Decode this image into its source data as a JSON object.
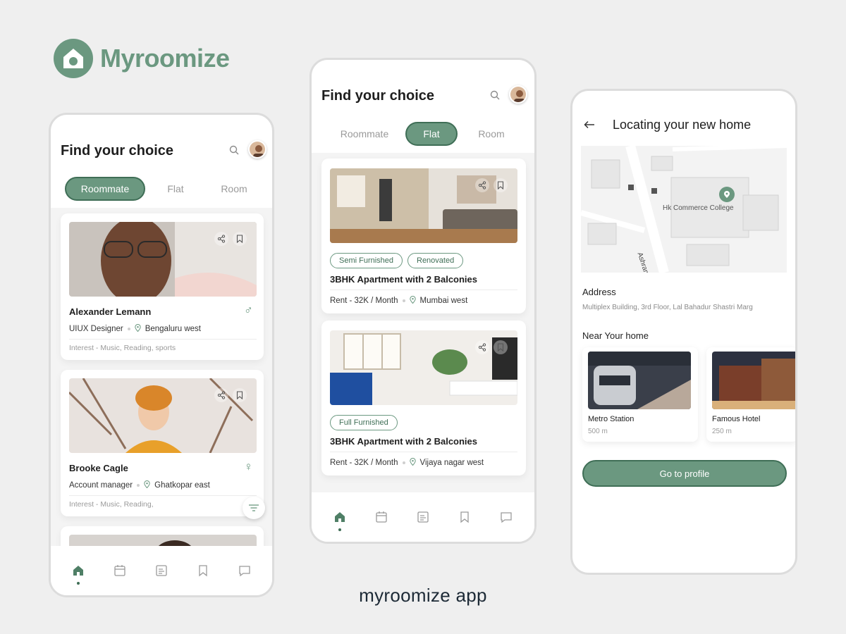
{
  "brand": {
    "name": "Myroomize",
    "color": "#6b9880",
    "logo_icon": "house-icon"
  },
  "caption": "myroomize app",
  "colors": {
    "accent": "#6b9880",
    "accent_dark": "#3f6e56",
    "background": "#efefef"
  },
  "screen1": {
    "title": "Find your choice",
    "tabs": [
      {
        "label": "Roommate",
        "active": true
      },
      {
        "label": "Flat",
        "active": false
      },
      {
        "label": "Room",
        "active": false
      }
    ],
    "cards": [
      {
        "name": "Alexander Lemann",
        "gender_icon": "male-symbol-icon",
        "gender_symbol": "♂",
        "role": "UIUX Designer",
        "location": "Bengaluru west",
        "interest": "Interest - Music, Reading, sports"
      },
      {
        "name": "Brooke Cagle",
        "gender_icon": "female-symbol-icon",
        "gender_symbol": "♀",
        "role": "Account manager",
        "location": "Ghatkopar east",
        "interest": "Interest - Music, Reading,"
      }
    ],
    "nav": [
      "home-icon",
      "calendar-icon",
      "notes-icon",
      "bookmark-icon",
      "chat-icon"
    ]
  },
  "screen2": {
    "title": "Find your choice",
    "tabs": [
      {
        "label": "Roommate",
        "active": false
      },
      {
        "label": "Flat",
        "active": true
      },
      {
        "label": "Room",
        "active": false
      }
    ],
    "cards": [
      {
        "tags": [
          "Semi Furnished",
          "Renovated"
        ],
        "title": "3BHK Apartment with 2 Balconies",
        "rent": "Rent - 32K / Month",
        "location": "Mumbai west"
      },
      {
        "tags": [
          "Full Furnished"
        ],
        "title": "3BHK Apartment with 2 Balconies",
        "rent": "Rent - 32K / Month",
        "location": "Vijaya nagar west"
      }
    ],
    "nav": [
      "home-icon",
      "calendar-icon",
      "notes-icon",
      "bookmark-icon",
      "chat-icon"
    ]
  },
  "screen3": {
    "title": "Locating your new home",
    "map_place": "Hk Commerce College",
    "map_street": "Ashram R",
    "address_label": "Address",
    "address": "Multiplex Building, 3rd Floor, Lal Bahadur Shastri Marg",
    "near_label": "Near Your home",
    "near": [
      {
        "title": "Metro Station",
        "distance": "500 m"
      },
      {
        "title": "Famous Hotel",
        "distance": "250 m"
      }
    ],
    "button": "Go to profile"
  }
}
